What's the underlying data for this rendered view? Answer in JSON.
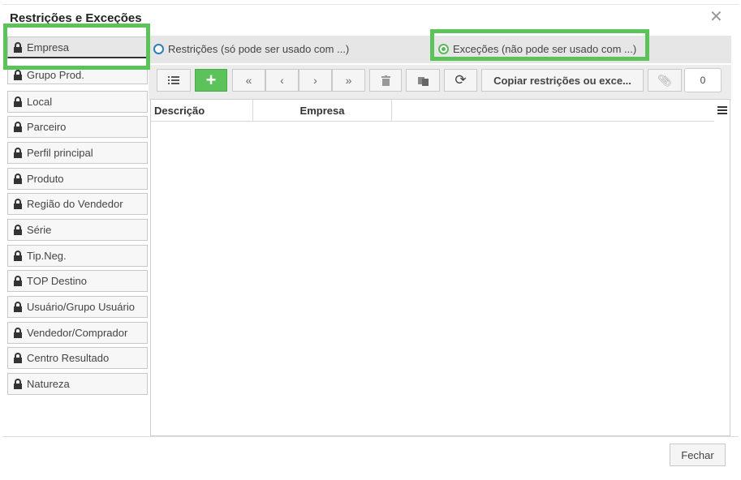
{
  "dialog": {
    "title": "Restrições e Exceções",
    "close_icon": "close-icon"
  },
  "sidebar": {
    "items": [
      {
        "label": "Empresa",
        "icon": "lock-icon",
        "active": true
      },
      {
        "label": "Grupo Prod.",
        "icon": "lock-icon"
      },
      {
        "label": "Local",
        "icon": "lock-icon"
      },
      {
        "label": "Parceiro",
        "icon": "lock-icon"
      },
      {
        "label": "Perfil principal",
        "icon": "lock-icon"
      },
      {
        "label": "Produto",
        "icon": "lock-icon"
      },
      {
        "label": "Região do Vendedor",
        "icon": "lock-icon"
      },
      {
        "label": "Série",
        "icon": "lock-icon"
      },
      {
        "label": "Tip.Neg.",
        "icon": "lock-icon"
      },
      {
        "label": "TOP Destino",
        "icon": "lock-icon"
      },
      {
        "label": "Usuário/Grupo Usuário",
        "icon": "lock-icon"
      },
      {
        "label": "Vendedor/Comprador",
        "icon": "lock-icon"
      },
      {
        "label": "Centro Resultado",
        "icon": "lock-icon"
      },
      {
        "label": "Natureza",
        "icon": "lock-icon"
      }
    ]
  },
  "mode": {
    "restricoes_label": "Restrições (só pode ser usado com ...)",
    "excecoes_label": "Exceções (não pode ser usado com ...)",
    "selected": "excecoes"
  },
  "toolbar": {
    "copy_label": "Copiar restrições ou exce...",
    "count": "0"
  },
  "grid": {
    "columns": [
      "Descrição",
      "Empresa"
    ]
  },
  "footer": {
    "close_label": "Fechar"
  },
  "colors": {
    "highlight": "#5cc35a",
    "radio_off": "#2a7fb8",
    "radio_on": "#5cb85c"
  }
}
